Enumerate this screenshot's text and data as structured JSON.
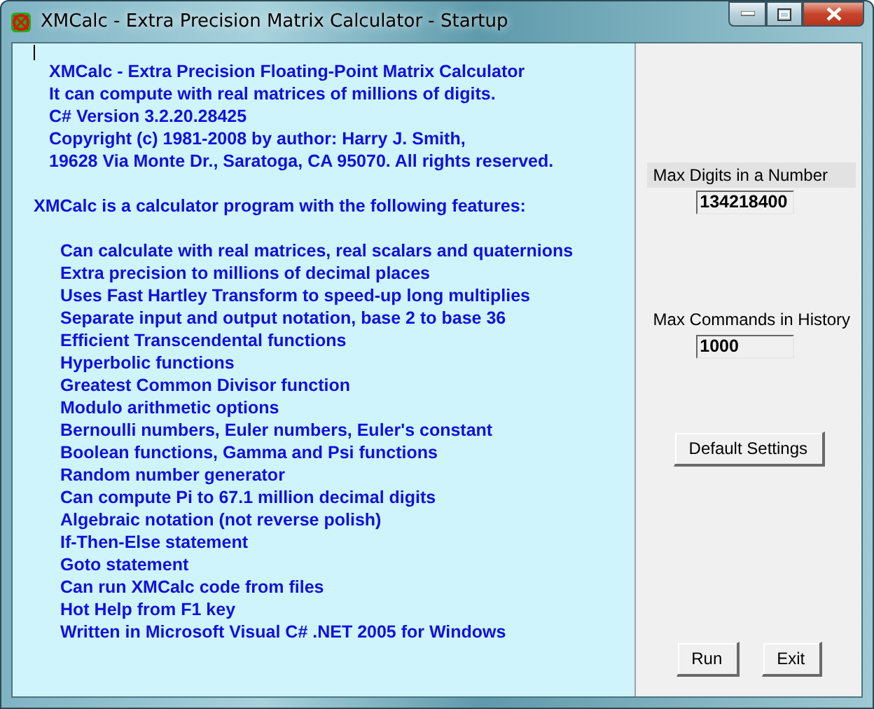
{
  "window": {
    "title": "XMCalc - Extra Precision Matrix Calculator - Startup"
  },
  "intro": [
    "XMCalc - Extra Precision Floating-Point Matrix Calculator",
    "It can compute with real matrices of millions of digits.",
    "C# Version 3.2.20.28425",
    "Copyright (c) 1981-2008 by author: Harry J. Smith,",
    "19628 Via Monte Dr., Saratoga, CA 95070.  All rights reserved."
  ],
  "heading": "XMCalc is a calculator program with the following features:",
  "features": [
    "Can calculate with real matrices, real scalars and quaternions",
    "Extra precision to millions of decimal places",
    "Uses Fast Hartley Transform to speed-up long multiplies",
    "Separate input and output notation, base 2 to base 36",
    "Efficient Transcendental functions",
    "Hyperbolic functions",
    "Greatest Common Divisor function",
    "Modulo arithmetic options",
    "Bernoulli numbers, Euler numbers, Euler's constant",
    "Boolean functions, Gamma and Psi functions",
    "Random number generator",
    "Can compute Pi to 67.1 million decimal digits",
    "Algebraic notation (not reverse polish)",
    "If-Then-Else statement",
    "Goto statement",
    "Can run XMCalc code from files",
    "Hot Help from F1 key",
    "Written in Microsoft Visual C# .NET 2005 for Windows"
  ],
  "settings": [
    {
      "label": "Max Digits in a Number",
      "value": "134218400",
      "highlighted": true
    },
    {
      "label": "Max Commands in History",
      "value": "1000",
      "highlighted": false
    }
  ],
  "default_button": "Default Settings",
  "buttons": [
    "Run",
    "Exit"
  ]
}
